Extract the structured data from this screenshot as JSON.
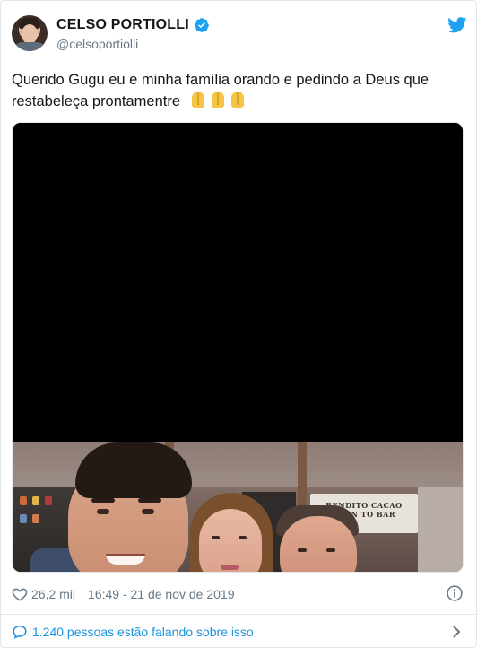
{
  "author": {
    "display_name": "CELSO PORTIOLLI",
    "handle": "@celsoportiolli",
    "verified": true
  },
  "icons": {
    "avatar": "avatar",
    "verified": "verified-badge-icon",
    "platform": "twitter-bird-icon",
    "like": "heart-icon",
    "info": "info-icon",
    "replies": "speech-bubble-icon",
    "more": "chevron-right-icon"
  },
  "tweet": {
    "text": "Querido Gugu eu e minha família orando e pedindo a Deus que restabeleça prontamentre",
    "emoji": "folded-hands x3"
  },
  "media": {
    "type": "video",
    "photo_sign_line1": "BENDITO CACAO",
    "photo_sign_line2": "BEAN TO BAR"
  },
  "meta": {
    "likes": "26,2 mil",
    "timestamp": "16:49 - 21 de nov de 2019"
  },
  "footer": {
    "conversation": "1.240 pessoas estão falando sobre isso"
  },
  "colors": {
    "link": "#1b95e0",
    "twitter_blue": "#1da1f2",
    "text": "#14171a",
    "secondary": "#657786",
    "border": "#e1e8ed"
  }
}
